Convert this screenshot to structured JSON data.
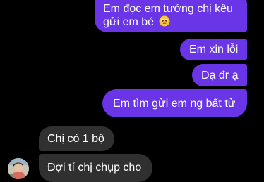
{
  "conversation": {
    "messages": [
      {
        "direction": "outgoing",
        "line1": "Em đọc em tưởng chị kêu",
        "line2": "gửi em bé",
        "emoji": "pleading-face-emoji"
      },
      {
        "direction": "outgoing",
        "text": "Em xin lỗi"
      },
      {
        "direction": "outgoing",
        "text": "Dạ đr ạ"
      },
      {
        "direction": "outgoing",
        "text": "Em tìm gửi em ng bất tử"
      },
      {
        "direction": "incoming",
        "text": "Chị có 1 bộ"
      },
      {
        "direction": "incoming",
        "text": "Đợi tí chị chụp cho"
      }
    ],
    "contact_avatar": "contact-avatar-photo"
  },
  "colors": {
    "background": "#000000",
    "outgoing_bubble": "#6a35e6",
    "incoming_bubble": "#303030",
    "text": "#ffffff"
  }
}
